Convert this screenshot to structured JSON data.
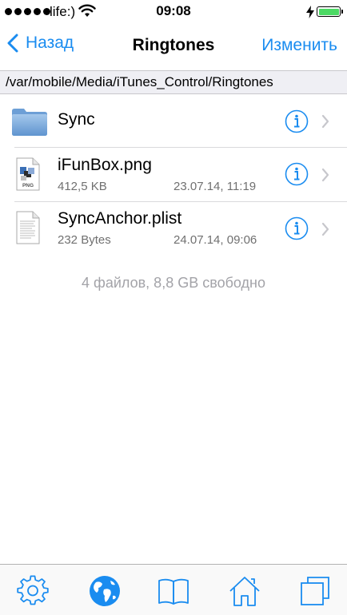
{
  "status_bar": {
    "carrier": "life:)",
    "time": "09:08"
  },
  "nav": {
    "back_label": "Назад",
    "title": "Ringtones",
    "edit_label": "Изменить"
  },
  "path": "/var/mobile/Media/iTunes_Control/Ringtones",
  "files": [
    {
      "name": "Sync",
      "type": "folder",
      "size": "",
      "date": "",
      "icon": "folder-icon"
    },
    {
      "name": "iFunBox.png",
      "type": "png",
      "size": "412,5 KB",
      "date": "23.07.14, 11:19",
      "icon": "png-file-icon"
    },
    {
      "name": "SyncAnchor.plist",
      "type": "plist",
      "size": "232 Bytes",
      "date": "24.07.14, 09:06",
      "icon": "document-file-icon"
    }
  ],
  "summary": "4 файлов, 8,8 GB свободно",
  "tabs": [
    {
      "name": "settings",
      "icon": "gear-icon"
    },
    {
      "name": "browser",
      "icon": "globe-icon"
    },
    {
      "name": "bookmarks",
      "icon": "book-icon"
    },
    {
      "name": "home",
      "icon": "home-icon"
    },
    {
      "name": "windows",
      "icon": "windows-icon"
    }
  ],
  "colors": {
    "accent": "#1a8cf0",
    "battery": "#4cd964",
    "secondary_text": "#707070",
    "footer_text": "#a3a3a8",
    "path_background": "#efeff4"
  },
  "icon_png_label": "PNG"
}
